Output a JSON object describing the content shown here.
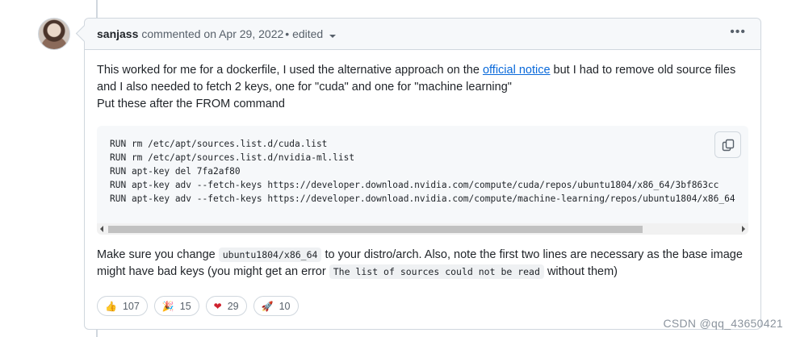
{
  "comment": {
    "author": "sanjass",
    "meta": "commented on Apr 29, 2022",
    "edited": "• edited",
    "menu": "•••"
  },
  "body": {
    "p1_before_link": "This worked for me for a dockerfile, I used the alternative approach on the ",
    "p1_link": "official notice",
    "p1_after_link": " but I had to remove old source files and I also needed to fetch 2 keys, one for \"cuda\" and one for \"machine learning\"",
    "p2": "Put these after the FROM command",
    "code_lines": [
      "RUN rm /etc/apt/sources.list.d/cuda.list",
      "RUN rm /etc/apt/sources.list.d/nvidia-ml.list",
      "RUN apt-key del 7fa2af80",
      "RUN apt-key adv --fetch-keys https://developer.download.nvidia.com/compute/cuda/repos/ubuntu1804/x86_64/3bf863cc",
      "RUN apt-key adv --fetch-keys https://developer.download.nvidia.com/compute/machine-learning/repos/ubuntu1804/x86_64"
    ],
    "p3_a": "Make sure you change ",
    "p3_code1": "ubuntu1804/x86_64",
    "p3_b": " to your distro/arch. Also, note the first two lines are necessary as the base image might have bad keys (you might get an error ",
    "p3_code2": "The list of sources could not be read",
    "p3_c": " without them)"
  },
  "reactions": [
    {
      "emoji": "👍",
      "icon": "thumbs-up-icon",
      "count": "107"
    },
    {
      "emoji": "🎉",
      "icon": "party-icon",
      "count": "15"
    },
    {
      "emoji": "❤",
      "icon": "heart-icon",
      "count": "29"
    },
    {
      "emoji": "🚀",
      "icon": "rocket-icon",
      "count": "10"
    }
  ],
  "watermark": "CSDN @qq_43650421",
  "colors": {
    "link": "#0969da",
    "border": "#d0d7de",
    "header_bg": "#f6f8fa"
  }
}
